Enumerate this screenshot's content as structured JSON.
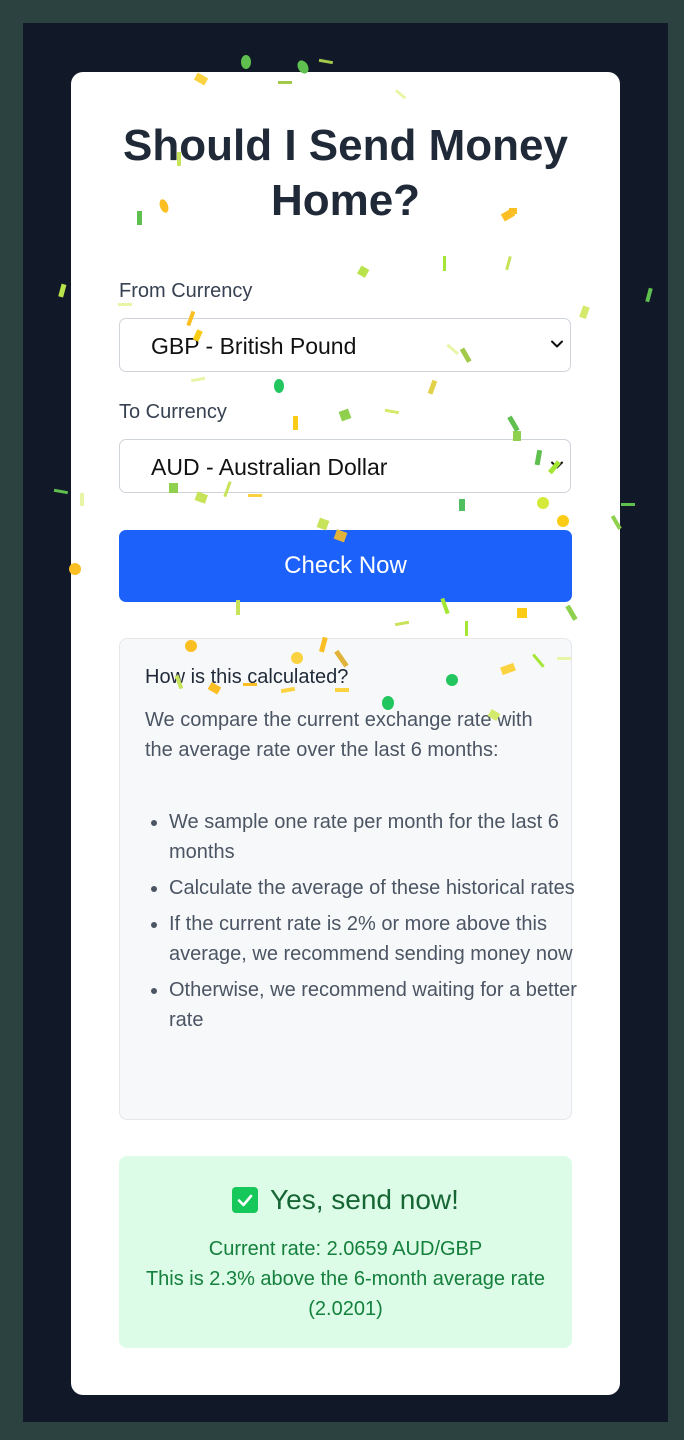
{
  "page": {
    "title": "Should I Send Money Home?"
  },
  "form": {
    "from_label": "From Currency",
    "from_value": "GBP - British Pound",
    "to_label": "To Currency",
    "to_value": "AUD - Australian Dollar",
    "submit_label": "Check Now"
  },
  "info": {
    "heading": "How is this calculated?",
    "body": "We compare the current exchange rate with the average rate over the last 6 months:",
    "steps": [
      "We sample one rate per month for the last 6 months",
      "Calculate the average of these historical rates",
      "If the current rate is 2% or more above this average, we recommend sending money now",
      "Otherwise, we recommend waiting for a better rate"
    ]
  },
  "result": {
    "headline": "Yes, send now!",
    "current_rate": "Current rate: 2.0659 AUD/GBP",
    "comparison": "This is 2.3% above the 6-month average rate (2.0201)"
  },
  "colors": {
    "page_bg": "#2b4240",
    "viewport_bg": "#111827",
    "card_bg": "#ffffff",
    "accent_button": "#1d61fb",
    "result_bg": "#dcfce7",
    "result_text": "#166534",
    "confetti": [
      "#fbbf24",
      "#a3e635",
      "#22c55e",
      "#facc15",
      "#d9f99d"
    ]
  },
  "icons": {
    "select_chevron": "chevron-down-icon",
    "result_check": "check-box-icon"
  }
}
